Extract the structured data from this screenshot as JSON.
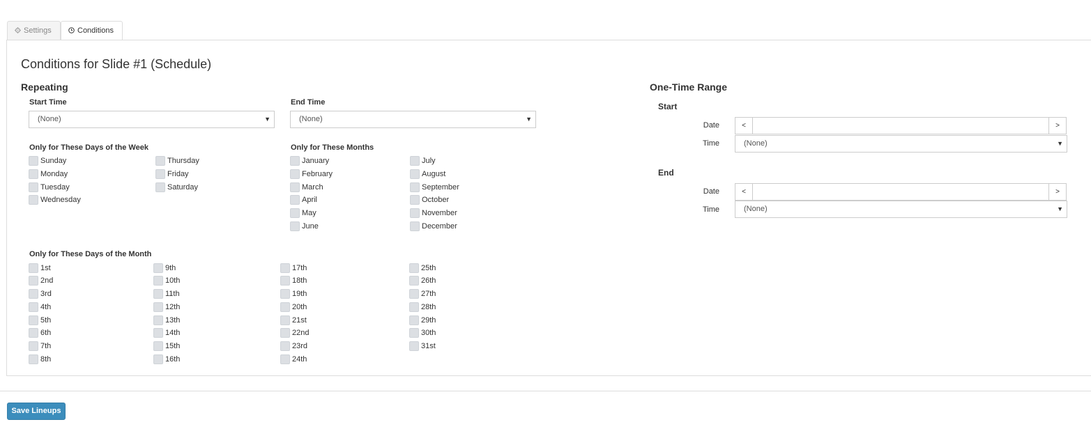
{
  "tabs": [
    {
      "label": "Settings",
      "icon": "gear-icon"
    },
    {
      "label": "Conditions",
      "icon": "clock-icon"
    }
  ],
  "page_title": "Conditions for Slide #1 (Schedule)",
  "repeating": {
    "heading": "Repeating",
    "start_time": {
      "label": "Start Time",
      "value": "(None)"
    },
    "end_time": {
      "label": "End Time",
      "value": "(None)"
    },
    "weekdays": {
      "label": "Only for These Days of the Week",
      "items": [
        "Sunday",
        "Monday",
        "Tuesday",
        "Wednesday",
        "Thursday",
        "Friday",
        "Saturday"
      ]
    },
    "months": {
      "label": "Only for These Months",
      "items": [
        "January",
        "February",
        "March",
        "April",
        "May",
        "June",
        "July",
        "August",
        "September",
        "October",
        "November",
        "December"
      ]
    },
    "month_days": {
      "label": "Only for These Days of the Month",
      "items": [
        "1st",
        "2nd",
        "3rd",
        "4th",
        "5th",
        "6th",
        "7th",
        "8th",
        "9th",
        "10th",
        "11th",
        "12th",
        "13th",
        "14th",
        "15th",
        "16th",
        "17th",
        "18th",
        "19th",
        "20th",
        "21st",
        "22nd",
        "23rd",
        "24th",
        "25th",
        "26th",
        "27th",
        "28th",
        "29th",
        "30th",
        "31st"
      ]
    }
  },
  "one_time": {
    "heading": "One-Time Range",
    "start": {
      "heading": "Start",
      "date_label": "Date",
      "date_value": "",
      "prev": "<",
      "next": ">",
      "time_label": "Time",
      "time_value": "(None)"
    },
    "end": {
      "heading": "End",
      "date_label": "Date",
      "date_value": "",
      "prev": "<",
      "next": ">",
      "time_label": "Time",
      "time_value": "(None)"
    }
  },
  "footer": {
    "save_label": "Save Lineups"
  },
  "colors": {
    "accent": "#3c8dbc",
    "checkbox": "#dcdfe3",
    "border": "#dddddd"
  }
}
